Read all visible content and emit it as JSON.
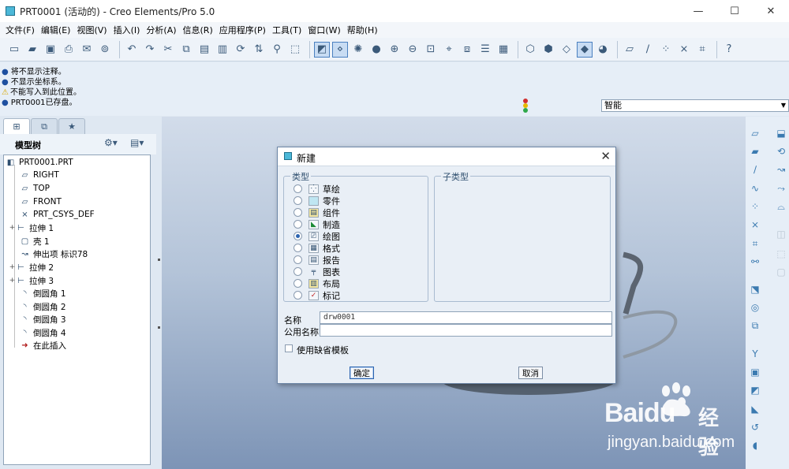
{
  "window": {
    "title": "PRT0001 (活动的) - Creo Elements/Pro 5.0",
    "controls": [
      "—",
      "☐",
      "✕"
    ]
  },
  "menubar": {
    "items": [
      "文件(F)",
      "编辑(E)",
      "视图(V)",
      "插入(I)",
      "分析(A)",
      "信息(R)",
      "应用程序(P)",
      "工具(T)",
      "窗口(W)",
      "帮助(H)"
    ]
  },
  "messages": {
    "lines": [
      "将不显示注释。",
      "不显示坐标系。",
      "不能写入到此位置。",
      "PRT0001已存盘。"
    ],
    "filter": "智能"
  },
  "model_tree": {
    "title": "模型树",
    "items": [
      {
        "label": "PRT0001.PRT",
        "icon": "part-icon"
      },
      {
        "label": "RIGHT",
        "icon": "datum-plane-icon"
      },
      {
        "label": "TOP",
        "icon": "datum-plane-icon"
      },
      {
        "label": "FRONT",
        "icon": "datum-plane-icon"
      },
      {
        "label": "PRT_CSYS_DEF",
        "icon": "csys-icon"
      },
      {
        "label": "拉伸 1",
        "icon": "extrude-icon"
      },
      {
        "label": "壳 1",
        "icon": "shell-icon"
      },
      {
        "label": "伸出项 标识78",
        "icon": "sweep-icon"
      },
      {
        "label": "拉伸 2",
        "icon": "extrude-icon"
      },
      {
        "label": "拉伸 3",
        "icon": "extrude-icon"
      },
      {
        "label": "倒圆角 1",
        "icon": "round-icon"
      },
      {
        "label": "倒圆角 2",
        "icon": "round-icon"
      },
      {
        "label": "倒圆角 3",
        "icon": "round-icon"
      },
      {
        "label": "倒圆角 4",
        "icon": "round-icon"
      },
      {
        "label": "在此插入",
        "icon": "insert-here-icon"
      }
    ]
  },
  "dialog": {
    "title": "新建",
    "type_group_label": "类型",
    "subtype_group_label": "子类型",
    "types": [
      "草绘",
      "零件",
      "组件",
      "制造",
      "绘图",
      "格式",
      "报告",
      "图表",
      "布局",
      "标记"
    ],
    "selected_type": "绘图",
    "name_label": "名称",
    "name_value": "drw0001",
    "common_name_label": "公用名称",
    "common_name_value": "",
    "use_default_template_label": "使用缺省模板",
    "use_default_template": false,
    "ok_label": "确定",
    "cancel_label": "取消"
  },
  "watermark": {
    "brand": "Baidu",
    "brand_cn": "经验",
    "url": "jingyan.baidu.com"
  },
  "colors": {
    "accent": "#2c64b0",
    "graphics_top": "#d2dcea",
    "graphics_bottom": "#7d94b6"
  }
}
